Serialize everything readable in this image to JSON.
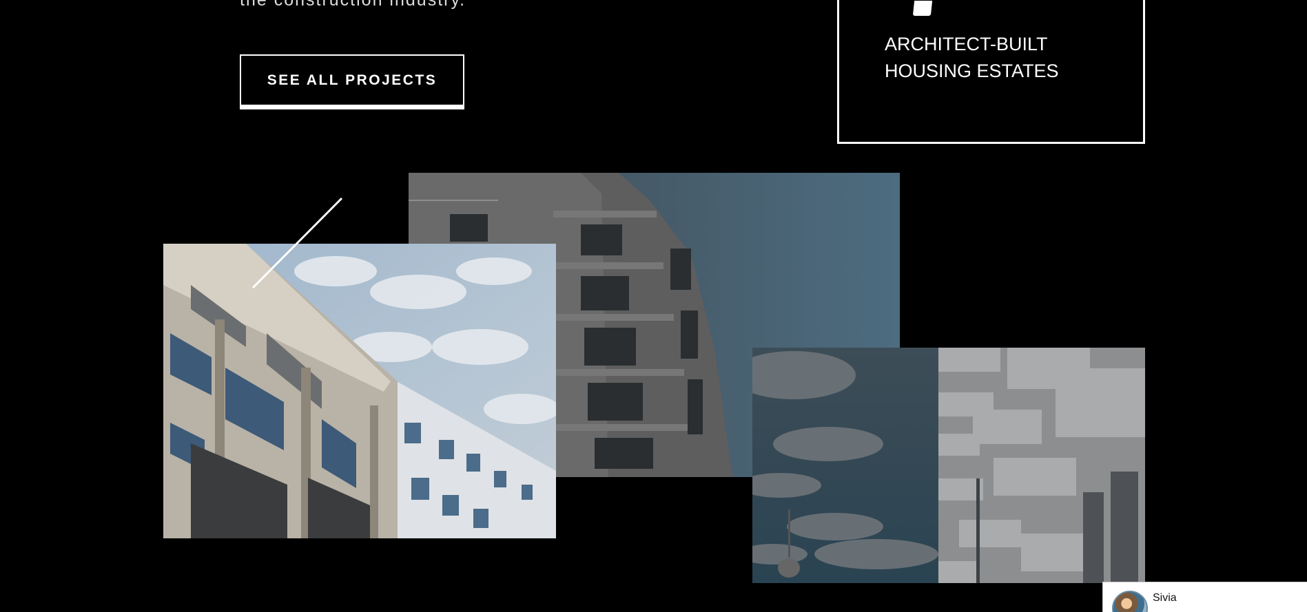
{
  "intro": {
    "tail_text": "the construction industry."
  },
  "cta": {
    "label": "SEE ALL PROJECTS"
  },
  "feature_card": {
    "label_line1": "ARCHITECT-BUILT",
    "label_line2": "HOUSING ESTATES",
    "icon": "document-icon"
  },
  "gallery": {
    "photos": [
      {
        "subject": "curved-apartment-building-balconies"
      },
      {
        "subject": "office-building-facade-cloudy-sky"
      },
      {
        "subject": "white-balcony-block-with-tv-tower"
      }
    ]
  },
  "chat": {
    "name": "Sivia"
  },
  "colors": {
    "background": "#000000",
    "foreground": "#ffffff"
  }
}
